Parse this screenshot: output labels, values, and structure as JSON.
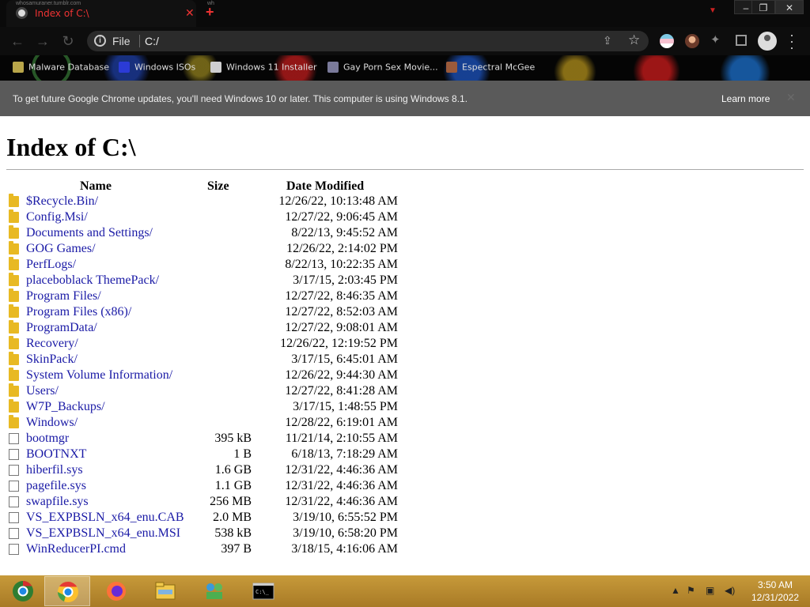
{
  "window": {
    "tab_title": "Index of C:\\",
    "tab_tiny_text": "whosamuraner.tumblr.com",
    "new_tab_tiny_text": "wh",
    "controls": {
      "minimize": "–",
      "maximize": "❐",
      "close": "✕"
    }
  },
  "toolbar": {
    "omnibox_scheme": "File",
    "omnibox_url": "C:/"
  },
  "bookmarks": [
    {
      "label": "Malware Database",
      "icon_color": "#b9a64a"
    },
    {
      "label": "Windows ISOs",
      "icon_color": "#2b3bd6"
    },
    {
      "label": "Windows 11 Installer",
      "icon_color": "#cfcfcf"
    },
    {
      "label": "Gay Porn Sex Movie...",
      "icon_color": "#7a7a9a"
    },
    {
      "label": "Espectral McGee",
      "icon_color": "#9b5a3a"
    }
  ],
  "infobar": {
    "message": "To get future Google Chrome updates, you'll need Windows 10 or later. This computer is using Windows 8.1.",
    "learn_more": "Learn more"
  },
  "page": {
    "title": "Index of C:\\",
    "columns": {
      "name": "Name",
      "size": "Size",
      "date": "Date Modified"
    },
    "entries": [
      {
        "name": "$Recycle.Bin/",
        "size": "",
        "date": "12/26/22, 10:13:48 AM",
        "type": "folder"
      },
      {
        "name": "Config.Msi/",
        "size": "",
        "date": "12/27/22, 9:06:45 AM",
        "type": "folder"
      },
      {
        "name": "Documents and Settings/",
        "size": "",
        "date": "8/22/13, 9:45:52 AM",
        "type": "folder"
      },
      {
        "name": "GOG Games/",
        "size": "",
        "date": "12/26/22, 2:14:02 PM",
        "type": "folder"
      },
      {
        "name": "PerfLogs/",
        "size": "",
        "date": "8/22/13, 10:22:35 AM",
        "type": "folder"
      },
      {
        "name": "placeboblack ThemePack/",
        "size": "",
        "date": "3/17/15, 2:03:45 PM",
        "type": "folder"
      },
      {
        "name": "Program Files/",
        "size": "",
        "date": "12/27/22, 8:46:35 AM",
        "type": "folder"
      },
      {
        "name": "Program Files (x86)/",
        "size": "",
        "date": "12/27/22, 8:52:03 AM",
        "type": "folder"
      },
      {
        "name": "ProgramData/",
        "size": "",
        "date": "12/27/22, 9:08:01 AM",
        "type": "folder"
      },
      {
        "name": "Recovery/",
        "size": "",
        "date": "12/26/22, 12:19:52 PM",
        "type": "folder"
      },
      {
        "name": "SkinPack/",
        "size": "",
        "date": "3/17/15, 6:45:01 AM",
        "type": "folder"
      },
      {
        "name": "System Volume Information/",
        "size": "",
        "date": "12/26/22, 9:44:30 AM",
        "type": "folder"
      },
      {
        "name": "Users/",
        "size": "",
        "date": "12/27/22, 8:41:28 AM",
        "type": "folder"
      },
      {
        "name": "W7P_Backups/",
        "size": "",
        "date": "3/17/15, 1:48:55 PM",
        "type": "folder"
      },
      {
        "name": "Windows/",
        "size": "",
        "date": "12/28/22, 6:19:01 AM",
        "type": "folder"
      },
      {
        "name": "bootmgr",
        "size": "395 kB",
        "date": "11/21/14, 2:10:55 AM",
        "type": "file"
      },
      {
        "name": "BOOTNXT",
        "size": "1 B",
        "date": "6/18/13, 7:18:29 AM",
        "type": "file"
      },
      {
        "name": "hiberfil.sys",
        "size": "1.6 GB",
        "date": "12/31/22, 4:46:36 AM",
        "type": "file"
      },
      {
        "name": "pagefile.sys",
        "size": "1.1 GB",
        "date": "12/31/22, 4:46:36 AM",
        "type": "file"
      },
      {
        "name": "swapfile.sys",
        "size": "256 MB",
        "date": "12/31/22, 4:46:36 AM",
        "type": "file"
      },
      {
        "name": "VS_EXPBSLN_x64_enu.CAB",
        "size": "2.0 MB",
        "date": "3/19/10, 6:55:52 PM",
        "type": "file"
      },
      {
        "name": "VS_EXPBSLN_x64_enu.MSI",
        "size": "538 kB",
        "date": "3/19/10, 6:58:20 PM",
        "type": "file"
      },
      {
        "name": "WinReducerPI.cmd",
        "size": "397 B",
        "date": "3/18/15, 4:16:06 AM",
        "type": "file"
      }
    ]
  },
  "taskbar": {
    "apps": [
      {
        "name": "start-button",
        "icon": "chrome-logo-icon",
        "active": false
      },
      {
        "name": "taskbar-chrome",
        "icon": "chrome-icon",
        "active": true
      },
      {
        "name": "taskbar-firefox",
        "icon": "firefox-icon",
        "active": false
      },
      {
        "name": "taskbar-file-explorer",
        "icon": "folder-icon",
        "active": false
      },
      {
        "name": "taskbar-network-app",
        "icon": "network-icon",
        "active": false
      },
      {
        "name": "taskbar-cmd",
        "icon": "cmd-icon",
        "active": false
      }
    ],
    "clock_time": "3:50 AM",
    "clock_date": "12/31/2022"
  },
  "colors": {
    "link": "#1a1aa6",
    "folder": "#e8b923",
    "taskbar": "#b88a2e",
    "infobar": "#5a5a5a"
  }
}
